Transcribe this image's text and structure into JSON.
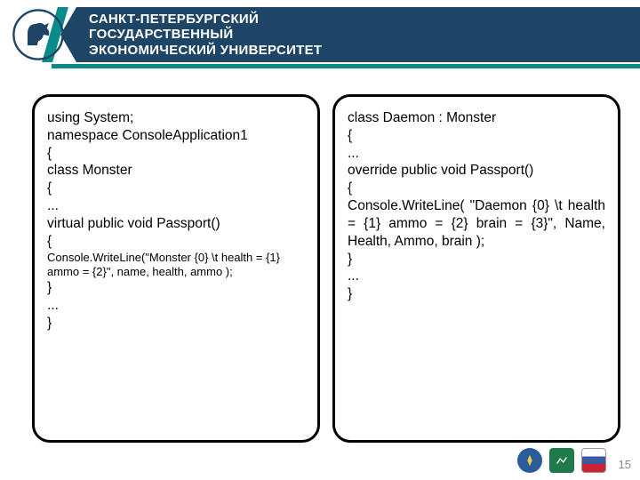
{
  "header": {
    "university_line1": "САНКТ-ПЕТЕРБУРГСКИЙ",
    "university_line2": "ГОСУДАРСТВЕННЫЙ",
    "university_line3": "ЭКОНОМИЧЕСКИЙ УНИВЕРСИТЕТ"
  },
  "code_left": {
    "l1": "using System;",
    "l2": "namespace ConsoleApplication1",
    "l3": "{",
    "l4": "class Monster",
    "l5": "{",
    "l6": "...",
    "l7": "virtual public void Passport()",
    "l8": "{",
    "l9": "Console.WriteLine(\"Monster {0} \\t health = {1} ammo = {2}\", name, health, ammo );",
    "l10": "}",
    "l11": "...",
    "l12": " }"
  },
  "code_right": {
    "l1": "class Daemon : Monster",
    "l2": "{",
    "l3": "...",
    "l4": "override public void Passport()",
    "l5": "{",
    "l6": "Console.WriteLine( \"Daemon {0} \\t health = {1} ammo = {2} brain = {3}\", Name, Health, Ammo, brain );",
    "l7": " }",
    "l8": " ...",
    "l9": "}"
  },
  "page_number": "15"
}
